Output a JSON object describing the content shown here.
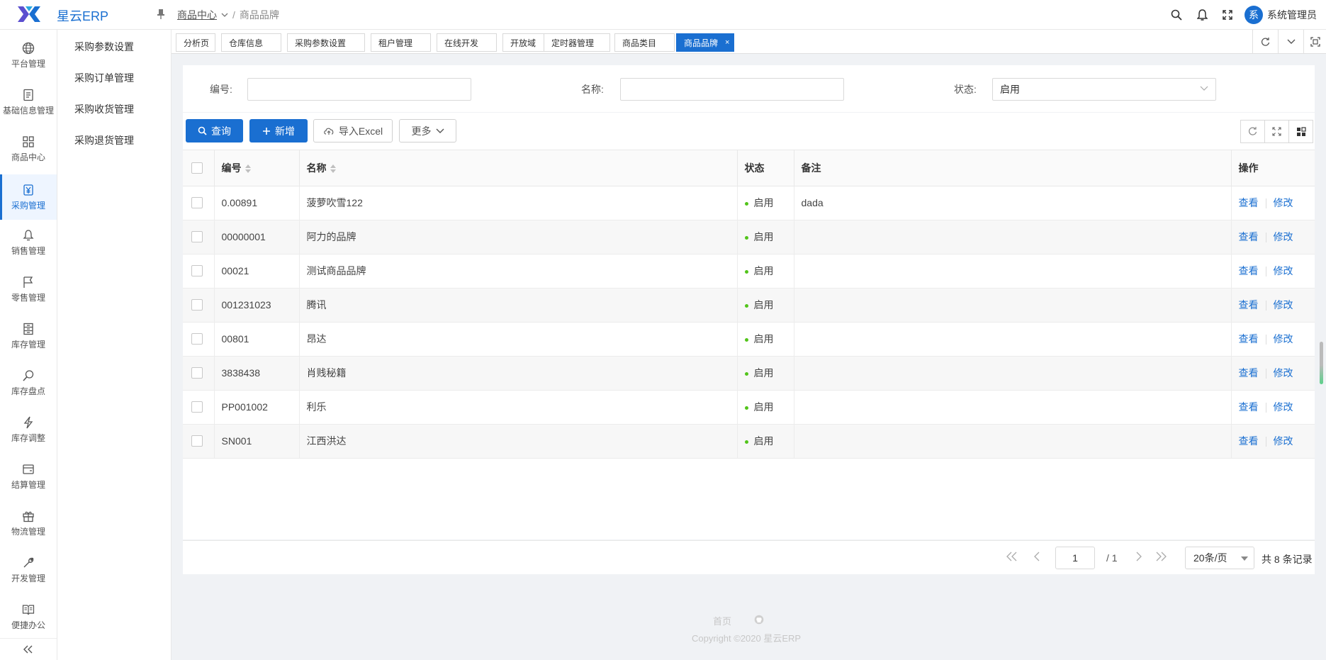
{
  "app": {
    "title": "星云ERP"
  },
  "breadcrumb": {
    "parent": "商品中心",
    "current": "商品品牌"
  },
  "user": {
    "avatar_char": "系",
    "name": "系统管理员"
  },
  "sidebar": {
    "items": [
      {
        "label": "平台管理",
        "icon": "globe-icon"
      },
      {
        "label": "基础信息管理",
        "icon": "document-icon"
      },
      {
        "label": "商品中心",
        "icon": "grid-icon"
      },
      {
        "label": "采购管理",
        "icon": "yen-icon",
        "active": true
      },
      {
        "label": "销售管理",
        "icon": "bell-icon"
      },
      {
        "label": "零售管理",
        "icon": "flag-icon"
      },
      {
        "label": "库存管理",
        "icon": "cabinet-icon"
      },
      {
        "label": "库存盘点",
        "icon": "magnifier-icon"
      },
      {
        "label": "库存调整",
        "icon": "lightning-icon"
      },
      {
        "label": "结算管理",
        "icon": "wallet-icon"
      },
      {
        "label": "物流管理",
        "icon": "gift-icon"
      },
      {
        "label": "开发管理",
        "icon": "wrench-icon"
      },
      {
        "label": "便捷办公",
        "icon": "book-icon"
      }
    ]
  },
  "submenu": {
    "items": [
      "采购参数设置",
      "采购订单管理",
      "采购收货管理",
      "采购退货管理"
    ]
  },
  "tabs": [
    {
      "label": "分析页"
    },
    {
      "label": "仓库信息"
    },
    {
      "label": "采购参数设置"
    },
    {
      "label": "租户管理"
    },
    {
      "label": "在线开发"
    },
    {
      "label": "开放域"
    },
    {
      "label": "定时器管理"
    },
    {
      "label": "商品类目"
    },
    {
      "label": "商品品牌",
      "active": true,
      "close": "×"
    }
  ],
  "search": {
    "code_label": "编号:",
    "code_value": "",
    "name_label": "名称:",
    "name_value": "",
    "status_label": "状态:",
    "status_value": "启用"
  },
  "toolbar": {
    "query_label": "查询",
    "add_label": "新增",
    "import_label": "导入Excel",
    "more_label": "更多"
  },
  "table": {
    "headers": {
      "code": "编号",
      "name": "名称",
      "status": "状态",
      "remark": "备注",
      "action": "操作"
    },
    "view_label": "查看",
    "edit_label": "修改",
    "rows": [
      {
        "code": "0.00891",
        "name": "菠萝吹雪122",
        "status": "启用",
        "remark": "dada"
      },
      {
        "code": "00000001",
        "name": "阿力的品牌",
        "status": "启用",
        "remark": ""
      },
      {
        "code": "00021",
        "name": "测试商品品牌",
        "status": "启用",
        "remark": ""
      },
      {
        "code": "001231023",
        "name": "腾讯",
        "status": "启用",
        "remark": ""
      },
      {
        "code": "00801",
        "name": "昂达",
        "status": "启用",
        "remark": ""
      },
      {
        "code": "3838438",
        "name": "肖贱秘籍",
        "status": "启用",
        "remark": ""
      },
      {
        "code": "PP001002",
        "name": "利乐",
        "status": "启用",
        "remark": ""
      },
      {
        "code": "SN001",
        "name": "江西洪达",
        "status": "启用",
        "remark": ""
      }
    ]
  },
  "pagination": {
    "current_page": "1",
    "total_pages": "/ 1",
    "page_size": "20条/页",
    "total": "共 8 条记录"
  },
  "footer": {
    "home": "首页",
    "copyright": "Copyright ©2020 星云ERP"
  },
  "colors": {
    "primary": "#1a6fd1",
    "status_green": "#52c41a"
  }
}
